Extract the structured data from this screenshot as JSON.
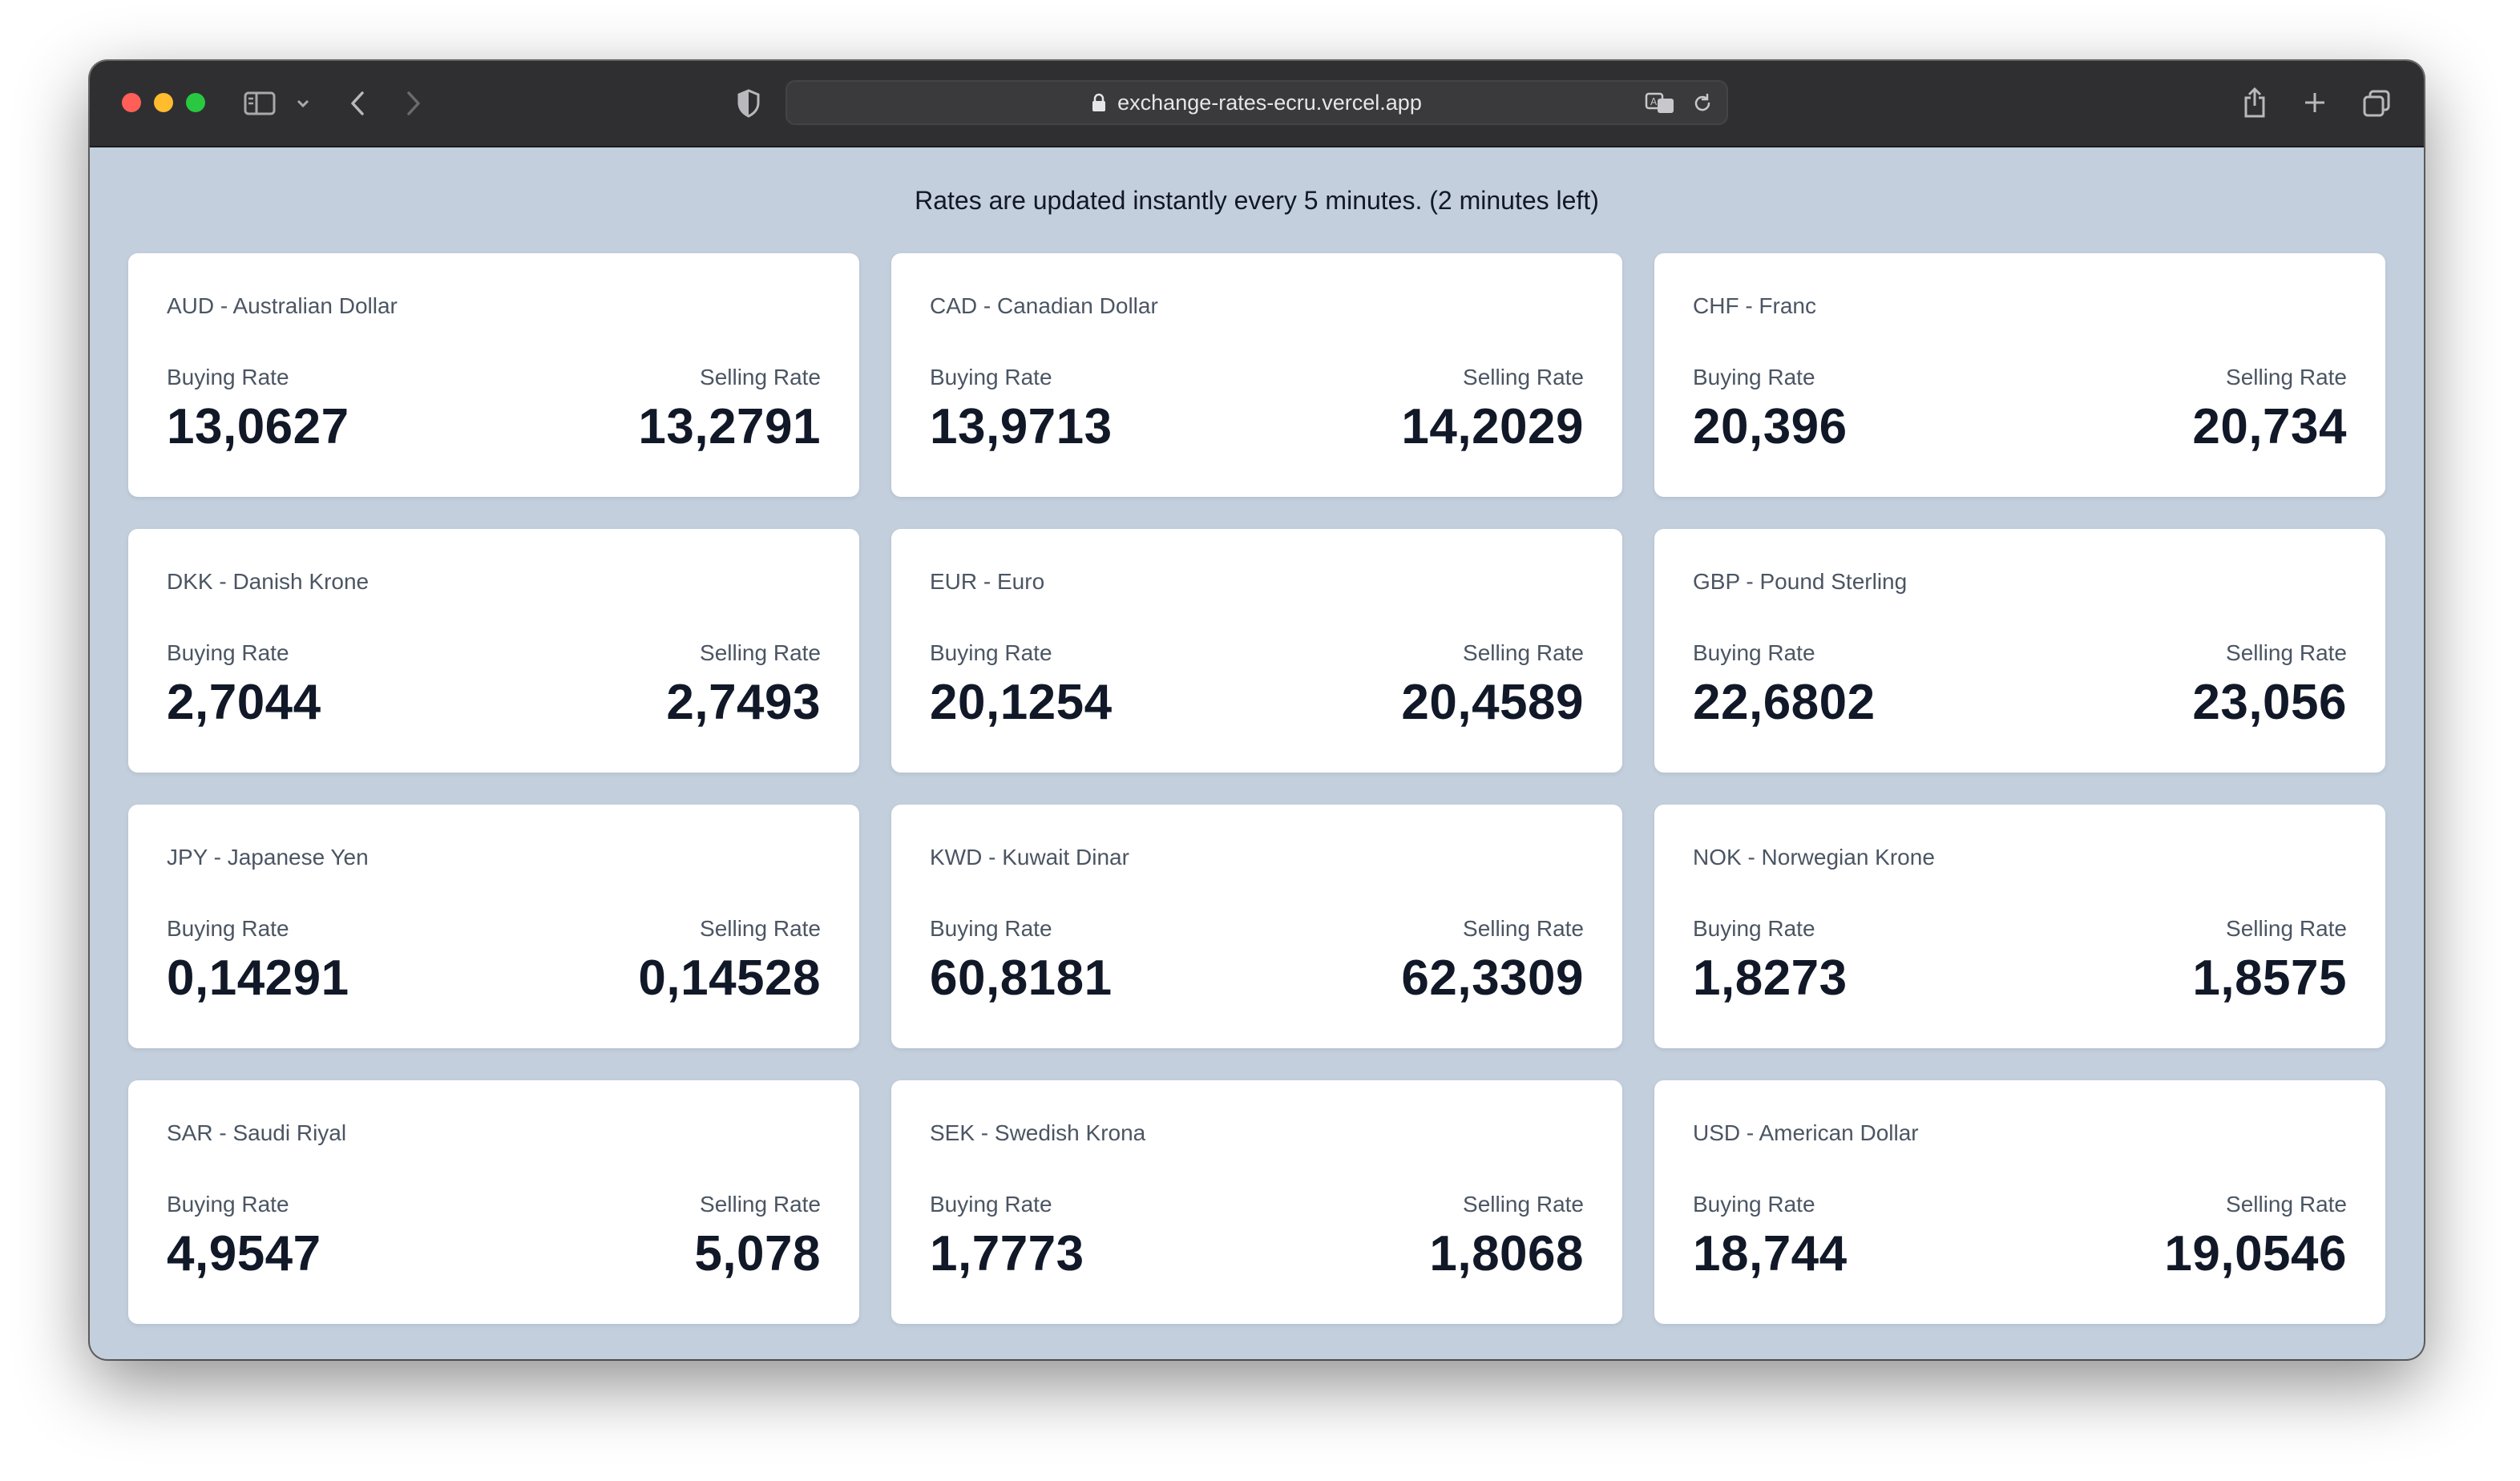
{
  "browser": {
    "url": "exchange-rates-ecru.vercel.app",
    "icons": {
      "sidebar": "sidebar-icon",
      "back": "chevron-left-icon",
      "forward": "chevron-right-icon",
      "shield": "shield-icon",
      "lock": "lock-icon",
      "translate": "translate-icon",
      "reload": "reload-icon",
      "share": "share-icon",
      "new_tab": "plus-icon",
      "tabs": "tabs-overview-icon"
    }
  },
  "page": {
    "notice": "Rates are updated instantly every 5 minutes. (2 minutes left)",
    "buying_label": "Buying Rate",
    "selling_label": "Selling Rate",
    "currencies": [
      {
        "title": "AUD - Australian Dollar",
        "buying": "13,0627",
        "selling": "13,2791"
      },
      {
        "title": "CAD - Canadian Dollar",
        "buying": "13,9713",
        "selling": "14,2029"
      },
      {
        "title": "CHF - Franc",
        "buying": "20,396",
        "selling": "20,734"
      },
      {
        "title": "DKK - Danish Krone",
        "buying": "2,7044",
        "selling": "2,7493"
      },
      {
        "title": "EUR - Euro",
        "buying": "20,1254",
        "selling": "20,4589"
      },
      {
        "title": "GBP - Pound Sterling",
        "buying": "22,6802",
        "selling": "23,056"
      },
      {
        "title": "JPY - Japanese Yen",
        "buying": "0,14291",
        "selling": "0,14528"
      },
      {
        "title": "KWD - Kuwait Dinar",
        "buying": "60,8181",
        "selling": "62,3309"
      },
      {
        "title": "NOK - Norwegian Krone",
        "buying": "1,8273",
        "selling": "1,8575"
      },
      {
        "title": "SAR - Saudi Riyal",
        "buying": "4,9547",
        "selling": "5,078"
      },
      {
        "title": "SEK - Swedish Krona",
        "buying": "1,7773",
        "selling": "1,8068"
      },
      {
        "title": "USD - American Dollar",
        "buying": "18,744",
        "selling": "19,0546"
      }
    ]
  },
  "colors": {
    "background": "#c3cfdd",
    "card": "#ffffff",
    "text_primary": "#111827",
    "text_secondary": "#4b5563",
    "titlebar": "#2f2f31"
  }
}
